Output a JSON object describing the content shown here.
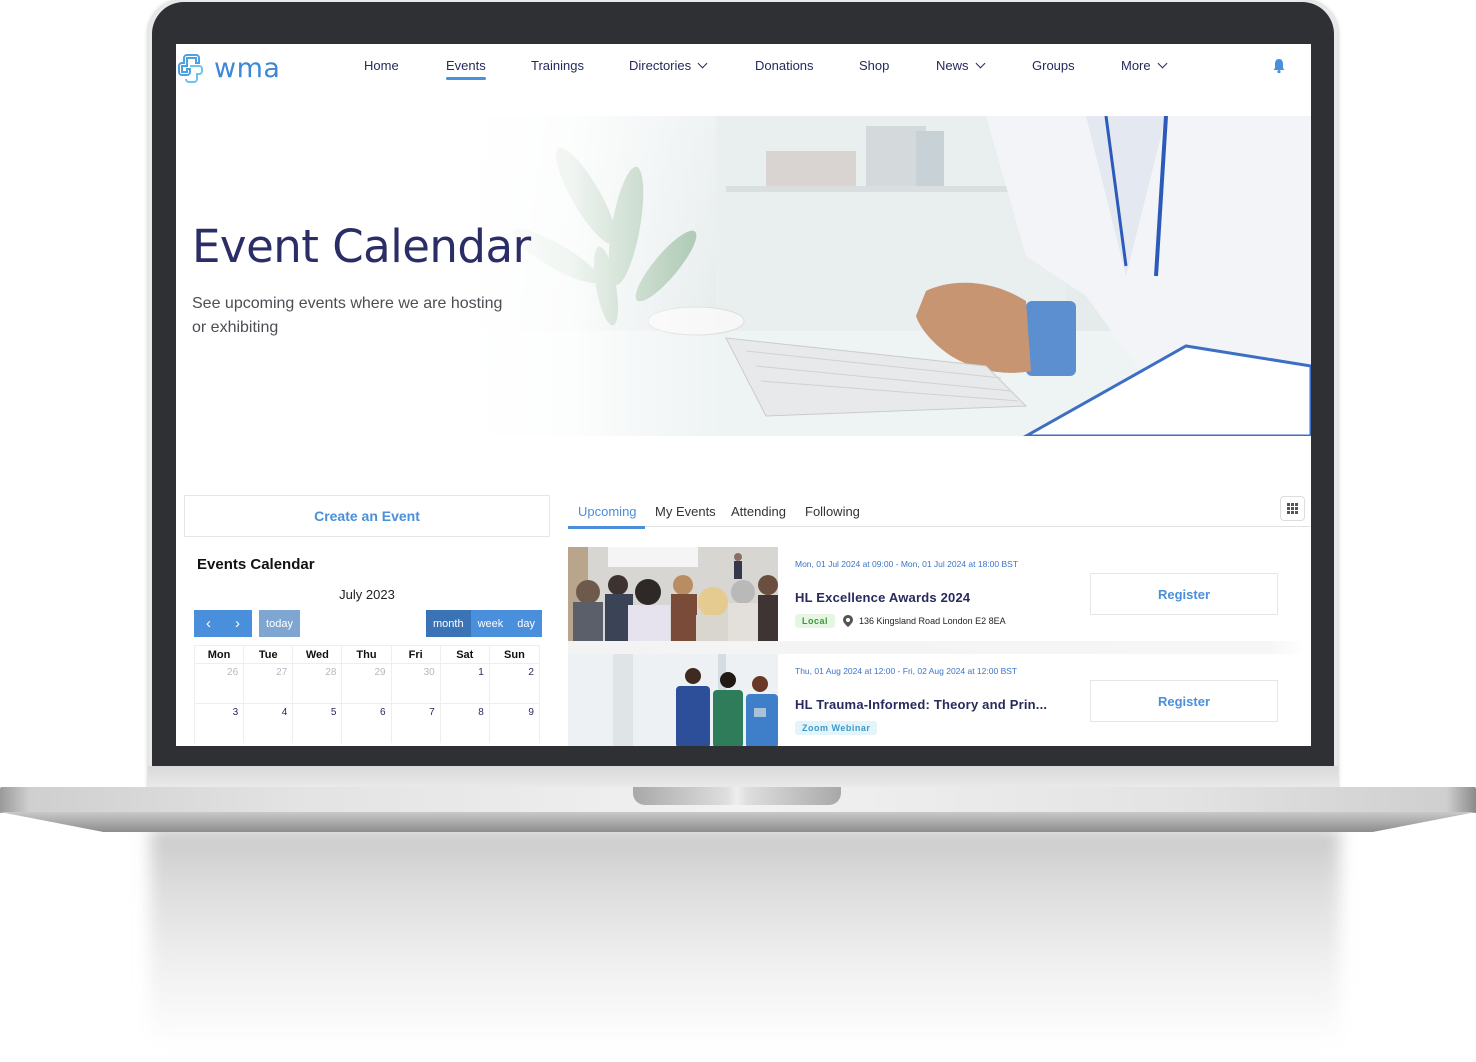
{
  "brand": {
    "name": "wma",
    "accent": "#4a8fdb",
    "title_color": "#2b2d66"
  },
  "nav": {
    "items": [
      {
        "label": "Home",
        "dropdown": false,
        "active": false
      },
      {
        "label": "Events",
        "dropdown": false,
        "active": true
      },
      {
        "label": "Trainings",
        "dropdown": false,
        "active": false
      },
      {
        "label": "Directories",
        "dropdown": true,
        "active": false
      },
      {
        "label": "Donations",
        "dropdown": false,
        "active": false
      },
      {
        "label": "Shop",
        "dropdown": false,
        "active": false
      },
      {
        "label": "News",
        "dropdown": true,
        "active": false
      },
      {
        "label": "Groups",
        "dropdown": false,
        "active": false
      },
      {
        "label": "More",
        "dropdown": true,
        "active": false
      }
    ],
    "notification_icon": "bell-icon"
  },
  "hero": {
    "title": "Event Calendar",
    "subtitle": "See upcoming events where we are hosting or exhibiting",
    "image": "doctor-typing-on-keyboard"
  },
  "sidebar": {
    "create_event_label": "Create an Event",
    "calendar": {
      "title": "Events Calendar",
      "month_label": "July 2023",
      "prev_label": "‹",
      "next_label": "›",
      "today_label": "today",
      "views": [
        {
          "label": "month",
          "active": true
        },
        {
          "label": "week",
          "active": false
        },
        {
          "label": "day",
          "active": false
        }
      ],
      "weekdays": [
        "Mon",
        "Tue",
        "Wed",
        "Thu",
        "Fri",
        "Sat",
        "Sun"
      ],
      "weeks": [
        [
          {
            "day": "26",
            "other": true
          },
          {
            "day": "27",
            "other": true
          },
          {
            "day": "28",
            "other": true
          },
          {
            "day": "29",
            "other": true
          },
          {
            "day": "30",
            "other": true
          },
          {
            "day": "1",
            "other": false
          },
          {
            "day": "2",
            "other": false
          }
        ],
        [
          {
            "day": "3",
            "other": false
          },
          {
            "day": "4",
            "other": false
          },
          {
            "day": "5",
            "other": false
          },
          {
            "day": "6",
            "other": false
          },
          {
            "day": "7",
            "other": false
          },
          {
            "day": "8",
            "other": false
          },
          {
            "day": "9",
            "other": false
          }
        ]
      ]
    }
  },
  "events_panel": {
    "tabs": [
      {
        "label": "Upcoming",
        "active": true
      },
      {
        "label": "My Events",
        "active": false
      },
      {
        "label": "Attending",
        "active": false
      },
      {
        "label": "Following",
        "active": false
      }
    ],
    "view_toggle_icon": "grid-icon",
    "events": [
      {
        "date_range": "Mon, 01 Jul 2024 at 09:00 - Mon, 01 Jul 2024 at 18:00 BST",
        "name": "HL Excellence Awards 2024",
        "badge": "Local",
        "location": "136 Kingsland Road London E2 8EA",
        "image": "conference-audience",
        "register_label": "Register"
      },
      {
        "date_range": "Thu, 01 Aug 2024 at 12:00 - Fri, 02 Aug 2024 at 12:00 BST",
        "name": "HL Trauma-Informed: Theory and Prin...",
        "badge": "Zoom Webinar",
        "location": "",
        "image": "medical-staff-walking",
        "register_label": "Register"
      }
    ]
  }
}
